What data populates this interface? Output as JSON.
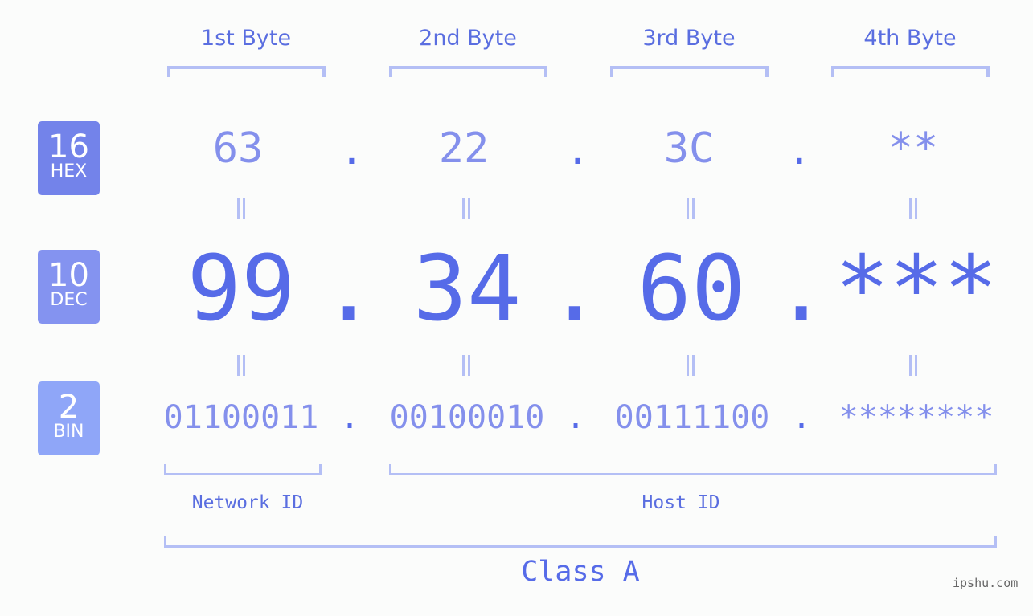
{
  "byte_headers": [
    "1st Byte",
    "2nd Byte",
    "3rd Byte",
    "4th Byte"
  ],
  "badges": [
    {
      "base": "16",
      "label": "HEX",
      "color": "#7383ea"
    },
    {
      "base": "10",
      "label": "DEC",
      "color": "#8493f0"
    },
    {
      "base": "2",
      "label": "BIN",
      "color": "#8fa6f8"
    }
  ],
  "hex": [
    "63",
    "22",
    "3C",
    "**"
  ],
  "dec": [
    "99",
    "34",
    "60",
    "***"
  ],
  "bin": [
    "01100011",
    "00100010",
    "00111100",
    "********"
  ],
  "separator": ".",
  "equals_symbol": "=",
  "network_label": "Network ID",
  "host_label": "Host ID",
  "class_label": "Class A",
  "watermark": "ipshu.com",
  "colors": {
    "accent": "#566be8",
    "light": "#8490ec",
    "bracket": "#b4bff5"
  }
}
